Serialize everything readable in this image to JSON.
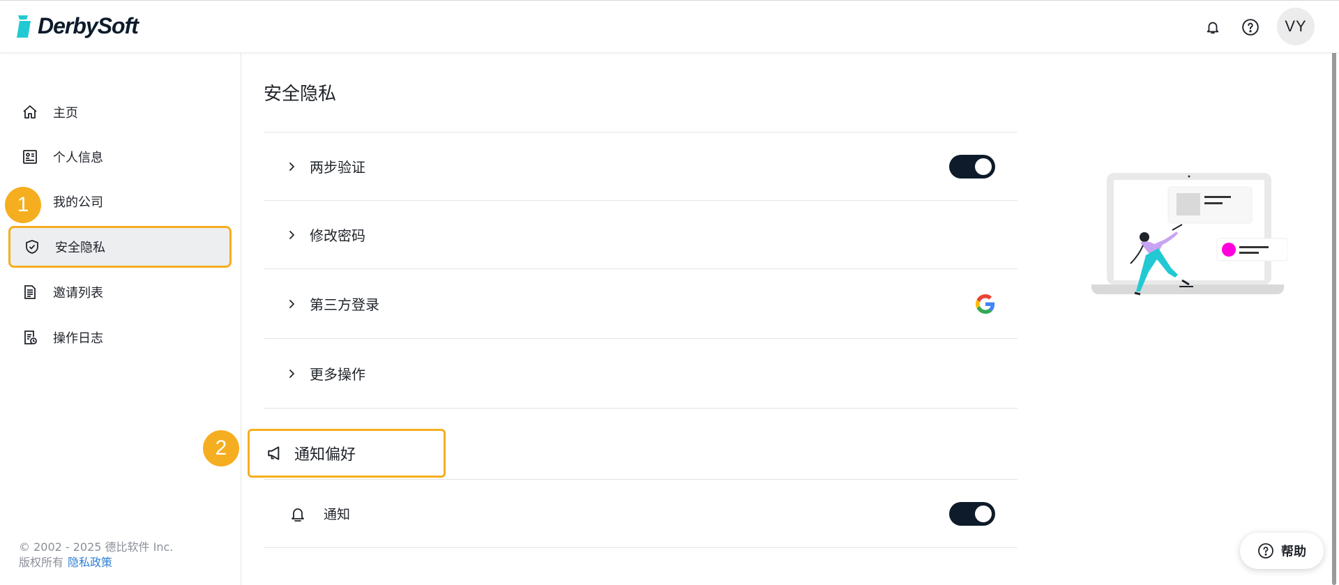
{
  "header": {
    "brand": "DerbySoft",
    "avatar_initials": "VY",
    "icons": [
      "bell-icon",
      "help-circle-icon"
    ]
  },
  "sidebar": {
    "items": [
      {
        "label": "主页",
        "icon": "home-icon"
      },
      {
        "label": "个人信息",
        "icon": "profile-card-icon"
      },
      {
        "label": "我的公司",
        "icon": "company-icon"
      },
      {
        "label": "安全隐私",
        "icon": "shield-check-icon",
        "active": true
      },
      {
        "label": "邀请列表",
        "icon": "document-list-icon"
      },
      {
        "label": "操作日志",
        "icon": "log-clock-icon"
      }
    ],
    "footer": {
      "copyright": "© 2002 - 2025 德比软件 Inc.",
      "rights": "版权所有",
      "privacy_link": "隐私政策"
    }
  },
  "annotations": {
    "badge1": "1",
    "badge2": "2"
  },
  "main": {
    "title": "安全隐私",
    "security_rows": [
      {
        "label": "两步验证",
        "toggle_on": true
      },
      {
        "label": "修改密码"
      },
      {
        "label": "第三方登录",
        "provider_icon": "google-icon"
      },
      {
        "label": "更多操作"
      }
    ],
    "notification_section": {
      "title": "通知偏好",
      "icon": "megaphone-icon",
      "rows": [
        {
          "label": "通知",
          "icon": "bell-icon",
          "toggle_on": true
        }
      ]
    }
  },
  "help_button": {
    "label": "帮助"
  },
  "colors": {
    "highlight": "#f5ae1f",
    "toggle_on": "#0d1b2a",
    "brand_teal": "#2ec4d6",
    "link": "#2f7fd6",
    "illustration_accent": "#f0f",
    "illustration_figure": "#22c9d3"
  }
}
